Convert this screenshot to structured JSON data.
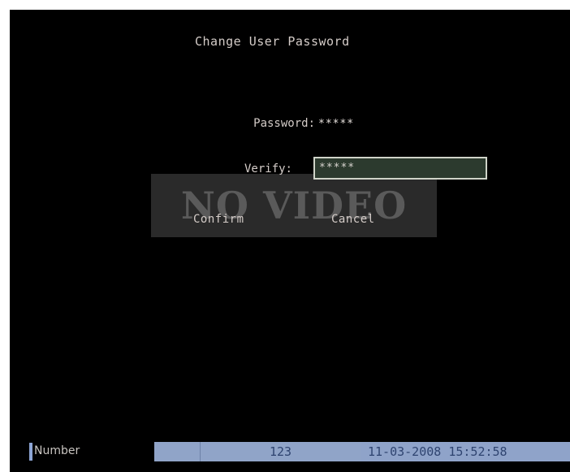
{
  "dialog": {
    "title": "Change User Password",
    "password_label": "Password:",
    "password_value": "*****",
    "verify_label": "Verify:",
    "verify_value": "*****",
    "confirm_label": "Confirm",
    "cancel_label": "Cancel"
  },
  "overlay": {
    "no_video_text": "NO VIDEO"
  },
  "status_bar": {
    "field_label": "Number",
    "number_value": "123",
    "datetime": "11-03-2008 15:52:58"
  },
  "colors": {
    "background": "#000000",
    "text": "#d4ccc8",
    "status_bar_fill": "#90a4c8",
    "status_bar_text": "#2f4470"
  }
}
